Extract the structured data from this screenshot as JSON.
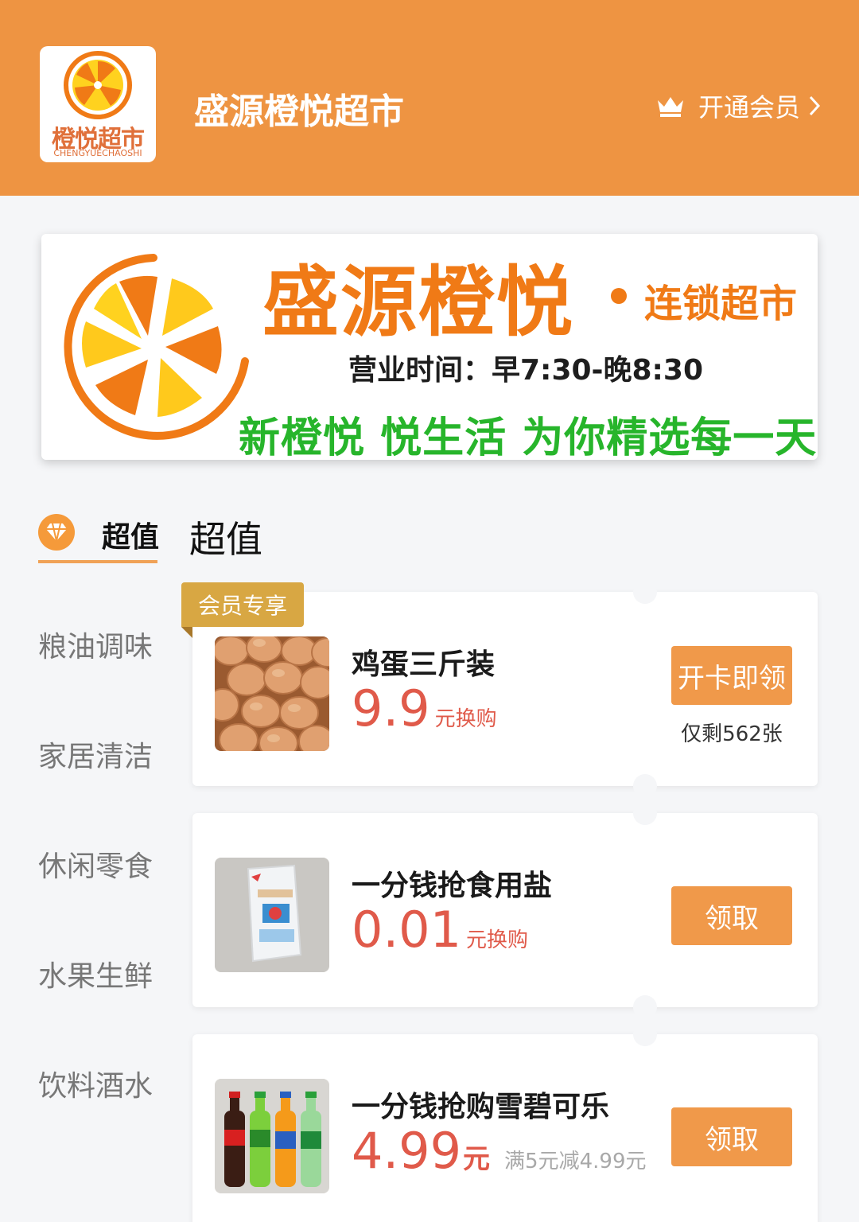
{
  "header": {
    "logo_text": "橙悦超市",
    "logo_subtext": "CHENGYUECHAOSHI",
    "store_name": "盛源橙悦超市",
    "member_link": "开通会员",
    "colors": {
      "header_bg": "#ee9442",
      "accent": "#f0994a",
      "price": "#e05a4a"
    }
  },
  "banner": {
    "title": "盛源橙悦",
    "subtitle": "连锁超市",
    "hours": "营业时间：早7:30-晚8:30",
    "slogan": "新橙悦 悦生活 为你精选每一天"
  },
  "section": {
    "tab_label": "超值",
    "title": "超值"
  },
  "categories": [
    "粮油调味",
    "家居清洁",
    "休闲零食",
    "水果生鲜",
    "饮料酒水"
  ],
  "products": [
    {
      "tag": "会员专享",
      "name": "鸡蛋三斤装",
      "price": "9.9",
      "price_unit": "元换购",
      "button": "开卡即领",
      "remaining": "仅剩562张"
    },
    {
      "name": "一分钱抢食用盐",
      "price": "0.01",
      "price_unit": "元换购",
      "button": "领取"
    },
    {
      "name": "一分钱抢购雪碧可乐",
      "price": "4.99",
      "price_unit": "元",
      "price_note": "满5元减4.99元",
      "button": "领取"
    }
  ]
}
